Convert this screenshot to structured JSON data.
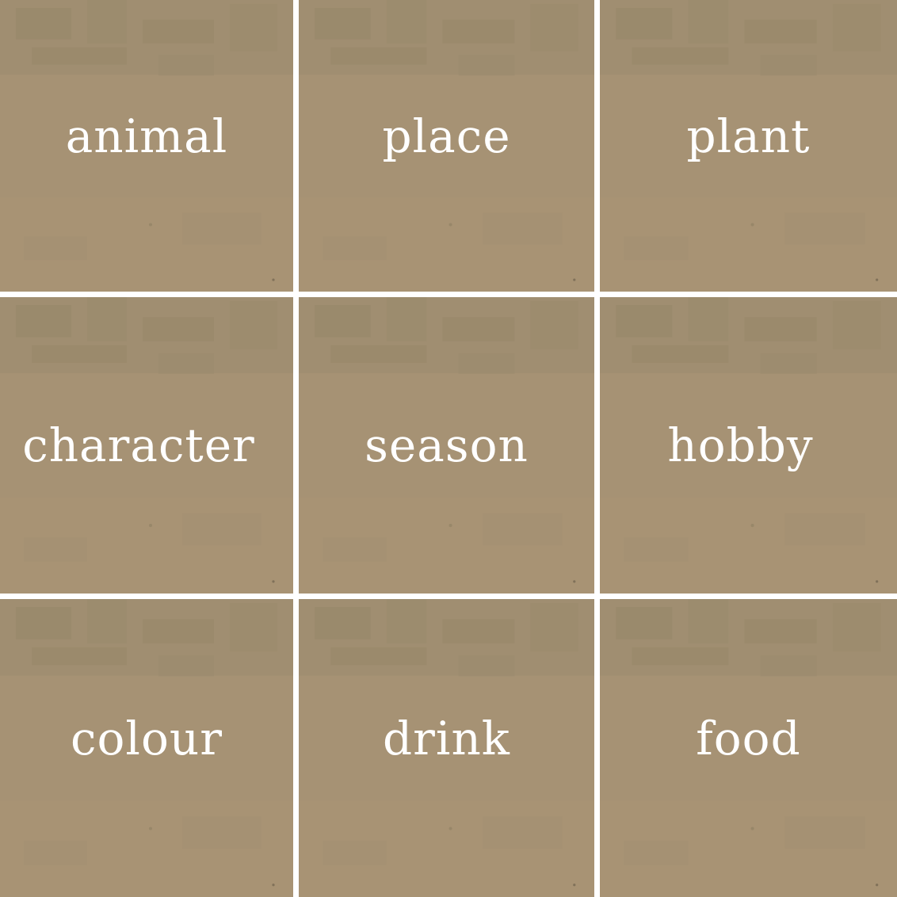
{
  "colors": {
    "tile_base": "#a69274",
    "tile_patch": "#9c8b70",
    "tile_light": "#ab9676",
    "divider": "#ffffff",
    "label": "#ffffff"
  },
  "tiles": [
    {
      "label": "animal"
    },
    {
      "label": "place"
    },
    {
      "label": "plant"
    },
    {
      "label": "character"
    },
    {
      "label": "season"
    },
    {
      "label": "hobby"
    },
    {
      "label": "colour"
    },
    {
      "label": "drink"
    },
    {
      "label": "food"
    }
  ]
}
